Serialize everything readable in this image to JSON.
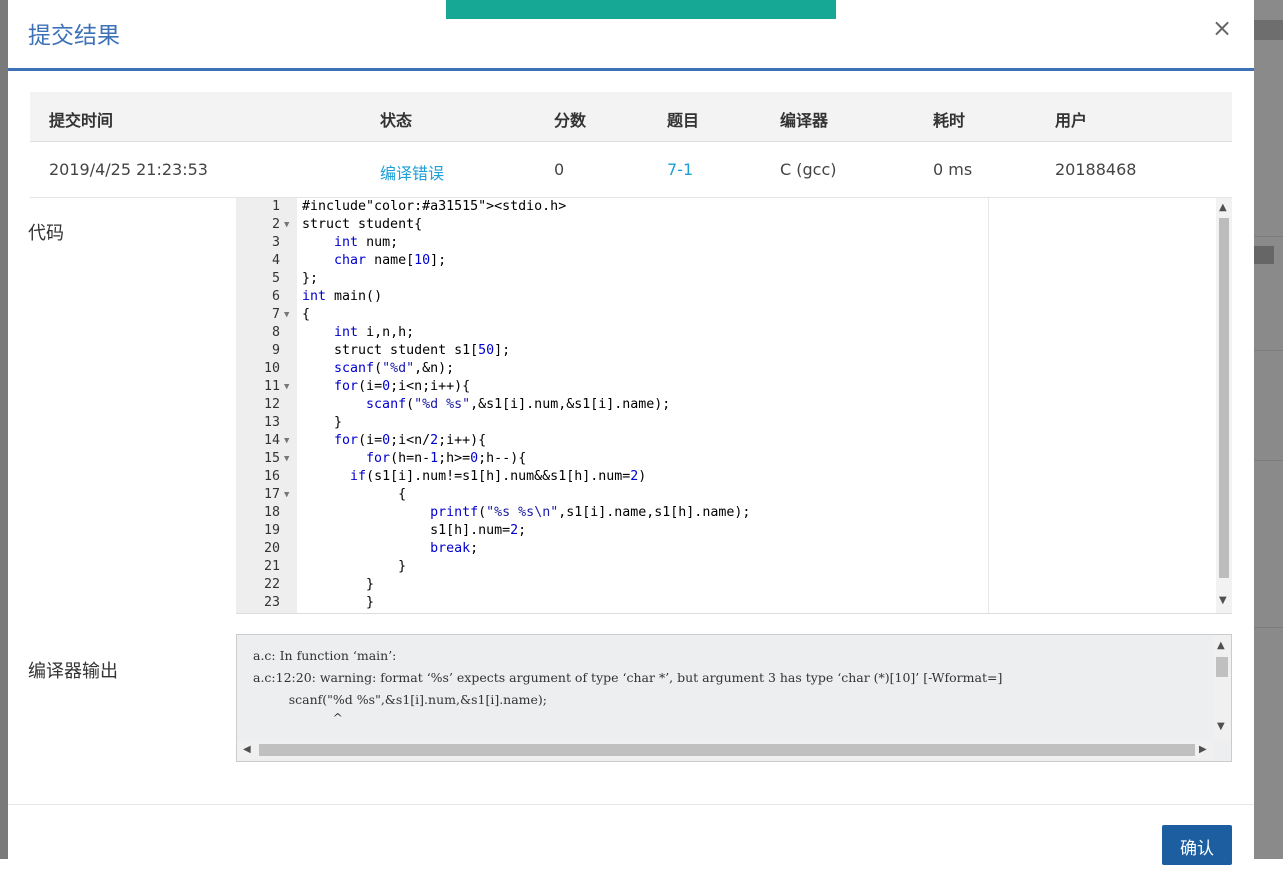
{
  "modal": {
    "title": "提交结果",
    "close_label": "×",
    "confirm_label": "确认"
  },
  "table": {
    "headers": [
      "提交时间",
      "状态",
      "分数",
      "题目",
      "编译器",
      "耗时",
      "用户"
    ],
    "row": {
      "time": "2019/4/25 21:23:53",
      "status": "编译错误",
      "score": "0",
      "problem": "7-1",
      "compiler": "C (gcc)",
      "duration": "0 ms",
      "user": "20188468"
    }
  },
  "labels": {
    "code": "代码",
    "compiler_output": "编译器输出"
  },
  "code_lines": [
    {
      "n": "1",
      "t": "#include<stdio.h>",
      "f": false
    },
    {
      "n": "2",
      "t": "struct student{",
      "f": true
    },
    {
      "n": "3",
      "t": "    int num;",
      "f": false
    },
    {
      "n": "4",
      "t": "    char name[10];",
      "f": false
    },
    {
      "n": "5",
      "t": "};",
      "f": false
    },
    {
      "n": "6",
      "t": "int main()",
      "f": false
    },
    {
      "n": "7",
      "t": "{",
      "f": true
    },
    {
      "n": "8",
      "t": "    int i,n,h;",
      "f": false
    },
    {
      "n": "9",
      "t": "    struct student s1[50];",
      "f": false
    },
    {
      "n": "10",
      "t": "    scanf(\"%d\",&n);",
      "f": false
    },
    {
      "n": "11",
      "t": "    for(i=0;i<n;i++){",
      "f": true
    },
    {
      "n": "12",
      "t": "        scanf(\"%d %s\",&s1[i].num,&s1[i].name);",
      "f": false
    },
    {
      "n": "13",
      "t": "    }",
      "f": false
    },
    {
      "n": "14",
      "t": "    for(i=0;i<n/2;i++){",
      "f": true
    },
    {
      "n": "15",
      "t": "        for(h=n-1;h>=0;h--){",
      "f": true
    },
    {
      "n": "16",
      "t": "      if(s1[i].num!=s1[h].num&&s1[h].num=2)",
      "f": false
    },
    {
      "n": "17",
      "t": "            {",
      "f": true
    },
    {
      "n": "18",
      "t": "                printf(\"%s %s\\n\",s1[i].name,s1[h].name);",
      "f": false
    },
    {
      "n": "19",
      "t": "                s1[h].num=2;",
      "f": false
    },
    {
      "n": "20",
      "t": "                break;",
      "f": false
    },
    {
      "n": "21",
      "t": "            }",
      "f": false
    },
    {
      "n": "22",
      "t": "        }",
      "f": false
    },
    {
      "n": "23",
      "t": "        }",
      "f": false
    }
  ],
  "compiler_output_lines": [
    "a.c: In function ‘main’:",
    "a.c:12:20: warning: format ‘%s’ expects argument of type ‘char *’, but argument 3 has type ‘char (*)[10]’ [-Wformat=]",
    "         scanf(\"%d %s\",&s1[i].num,&s1[i].name);",
    "                    ^"
  ],
  "colors": {
    "accent": "#3d72b8",
    "link": "#1e9fd6",
    "toast": "#16a894",
    "confirm": "#1d5ea0"
  }
}
